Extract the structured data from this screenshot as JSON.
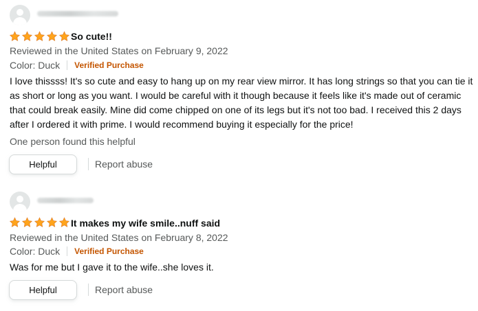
{
  "colors": {
    "star": "#ffa41c",
    "verified": "#c45500",
    "secondary": "#565959"
  },
  "icons": {
    "avatar": "default-profile-icon",
    "star": "star-icon"
  },
  "reviews": [
    {
      "rating": 5,
      "title": "So cute!!",
      "reviewed": "Reviewed in the United States on February 9, 2022",
      "color": "Color: Duck",
      "verified": "Verified Purchase",
      "text": "I love thissss! It's so cute and easy to hang up on my rear view mirror. It has long strings so that you can tie it as short or long as you want. I would be careful with it though because it feels like it's made out of ceramic that could break easily. Mine did come chipped on one of its legs but it's not too bad. I received this 2 days after I ordered it with prime. I would recommend buying it especially for the price!",
      "helpful_count": "One person found this helpful",
      "helpful_label": "Helpful",
      "report_label": "Report abuse"
    },
    {
      "rating": 5,
      "title": "It makes my wife smile..nuff said",
      "reviewed": "Reviewed in the United States on February 8, 2022",
      "color": "Color: Duck",
      "verified": "Verified Purchase",
      "text": "Was for me but I gave it to the wife..she loves it.",
      "helpful_label": "Helpful",
      "report_label": "Report abuse"
    }
  ]
}
